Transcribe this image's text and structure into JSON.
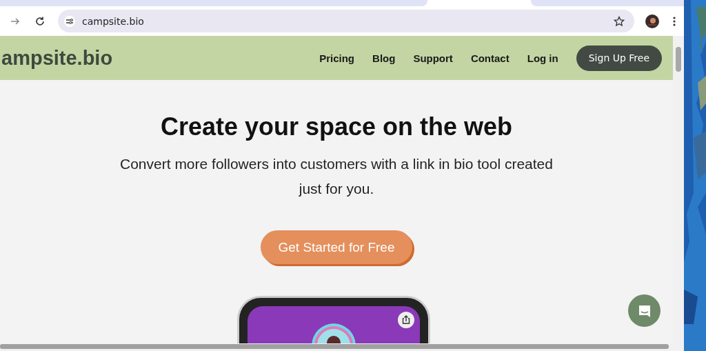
{
  "browser": {
    "url": "campsite.bio"
  },
  "nav": {
    "logo": "ampsite.bio",
    "links": [
      "Pricing",
      "Blog",
      "Support",
      "Contact",
      "Log in"
    ],
    "cta": "Sign Up Free"
  },
  "hero": {
    "title": "Create your space on the web",
    "subtitle": "Convert more followers into customers with a link in bio tool created just for you.",
    "button": "Get Started for Free"
  }
}
